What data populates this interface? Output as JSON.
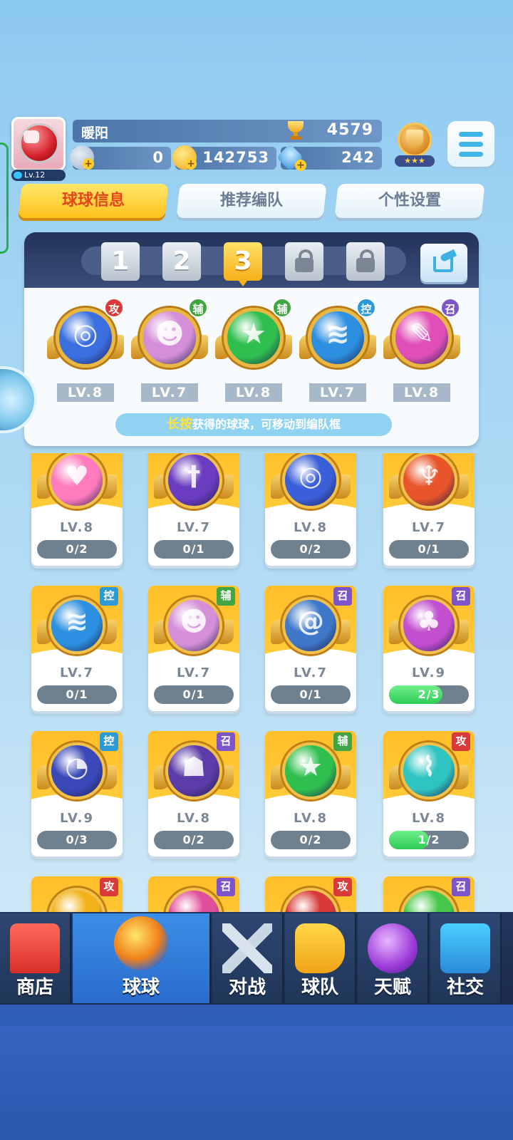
{
  "player": {
    "name": "暖阳",
    "level": "Lv.12",
    "trophies": "4579",
    "stamina": "0",
    "coins": "142753",
    "gems": "242"
  },
  "tabs": [
    {
      "label": "球球信息",
      "active": true
    },
    {
      "label": "推荐编队",
      "active": false
    },
    {
      "label": "个性设置",
      "active": false
    }
  ],
  "team_slots": [
    "1",
    "2",
    "3"
  ],
  "team": [
    {
      "tag": "攻",
      "level": "LV.8",
      "color": "#3b6fe0",
      "glyph": "◎"
    },
    {
      "tag": "辅",
      "level": "LV.7",
      "color": "#d48fd8",
      "glyph": "☻"
    },
    {
      "tag": "辅",
      "level": "LV.8",
      "color": "#2fbf4f",
      "glyph": "★"
    },
    {
      "tag": "控",
      "level": "LV.7",
      "color": "#2c8fe0",
      "glyph": "≋"
    },
    {
      "tag": "召",
      "level": "LV.8",
      "color": "#e04fb8",
      "glyph": "✎"
    }
  ],
  "hint": {
    "highlight": "长按",
    "text": "获得的球球，可移动到编队框"
  },
  "cards": [
    {
      "tag": "",
      "level": "LV.8",
      "progress": "0/2",
      "fill": 0,
      "color": "#ff7bbd",
      "glyph": "♥"
    },
    {
      "tag": "",
      "level": "LV.7",
      "progress": "0/1",
      "fill": 0,
      "color": "#6a3cc0",
      "glyph": "†"
    },
    {
      "tag": "",
      "level": "LV.8",
      "progress": "0/2",
      "fill": 0,
      "color": "#3b5fd8",
      "glyph": "◎"
    },
    {
      "tag": "",
      "level": "LV.7",
      "progress": "0/1",
      "fill": 0,
      "color": "#e8552a",
      "glyph": "♆"
    },
    {
      "tag": "控",
      "level": "LV.7",
      "progress": "0/1",
      "fill": 0,
      "color": "#2c8fe0",
      "glyph": "≋"
    },
    {
      "tag": "辅",
      "level": "LV.7",
      "progress": "0/1",
      "fill": 0,
      "color": "#d48fd8",
      "glyph": "☻"
    },
    {
      "tag": "召",
      "level": "LV.7",
      "progress": "0/1",
      "fill": 0,
      "color": "#3f78c8",
      "glyph": "@"
    },
    {
      "tag": "召",
      "level": "LV.9",
      "progress": "2/3",
      "fill": 0.667,
      "color": "#c24fd0",
      "glyph": "♣"
    },
    {
      "tag": "控",
      "level": "LV.9",
      "progress": "0/3",
      "fill": 0,
      "color": "#3a48b8",
      "glyph": "◔"
    },
    {
      "tag": "召",
      "level": "LV.8",
      "progress": "0/2",
      "fill": 0,
      "color": "#5b3ca8",
      "glyph": "☗"
    },
    {
      "tag": "辅",
      "level": "LV.8",
      "progress": "0/2",
      "fill": 0,
      "color": "#2fbf4f",
      "glyph": "★"
    },
    {
      "tag": "攻",
      "level": "LV.8",
      "progress": "1/2",
      "fill": 0.5,
      "color": "#2fc4c0",
      "glyph": "⌇"
    },
    {
      "tag": "攻",
      "level": "",
      "progress": "",
      "fill": 0,
      "color": "#f2b21c",
      "glyph": ""
    },
    {
      "tag": "召",
      "level": "",
      "progress": "",
      "fill": 0,
      "color": "#e04f9a",
      "glyph": ""
    },
    {
      "tag": "攻",
      "level": "",
      "progress": "",
      "fill": 0,
      "color": "#d83a3a",
      "glyph": ""
    },
    {
      "tag": "召",
      "level": "",
      "progress": "",
      "fill": 0,
      "color": "#48c84a",
      "glyph": ""
    }
  ],
  "nav": [
    {
      "label": "商店",
      "active": false
    },
    {
      "label": "球球",
      "active": true
    },
    {
      "label": "对战",
      "active": false
    },
    {
      "label": "球队",
      "active": false
    },
    {
      "label": "天赋",
      "active": false
    },
    {
      "label": "社交",
      "active": false
    }
  ],
  "colors": {
    "accent": "#ffc21e",
    "nav_active": "#3b8ee6",
    "progress_fill": "#2ecb55"
  }
}
